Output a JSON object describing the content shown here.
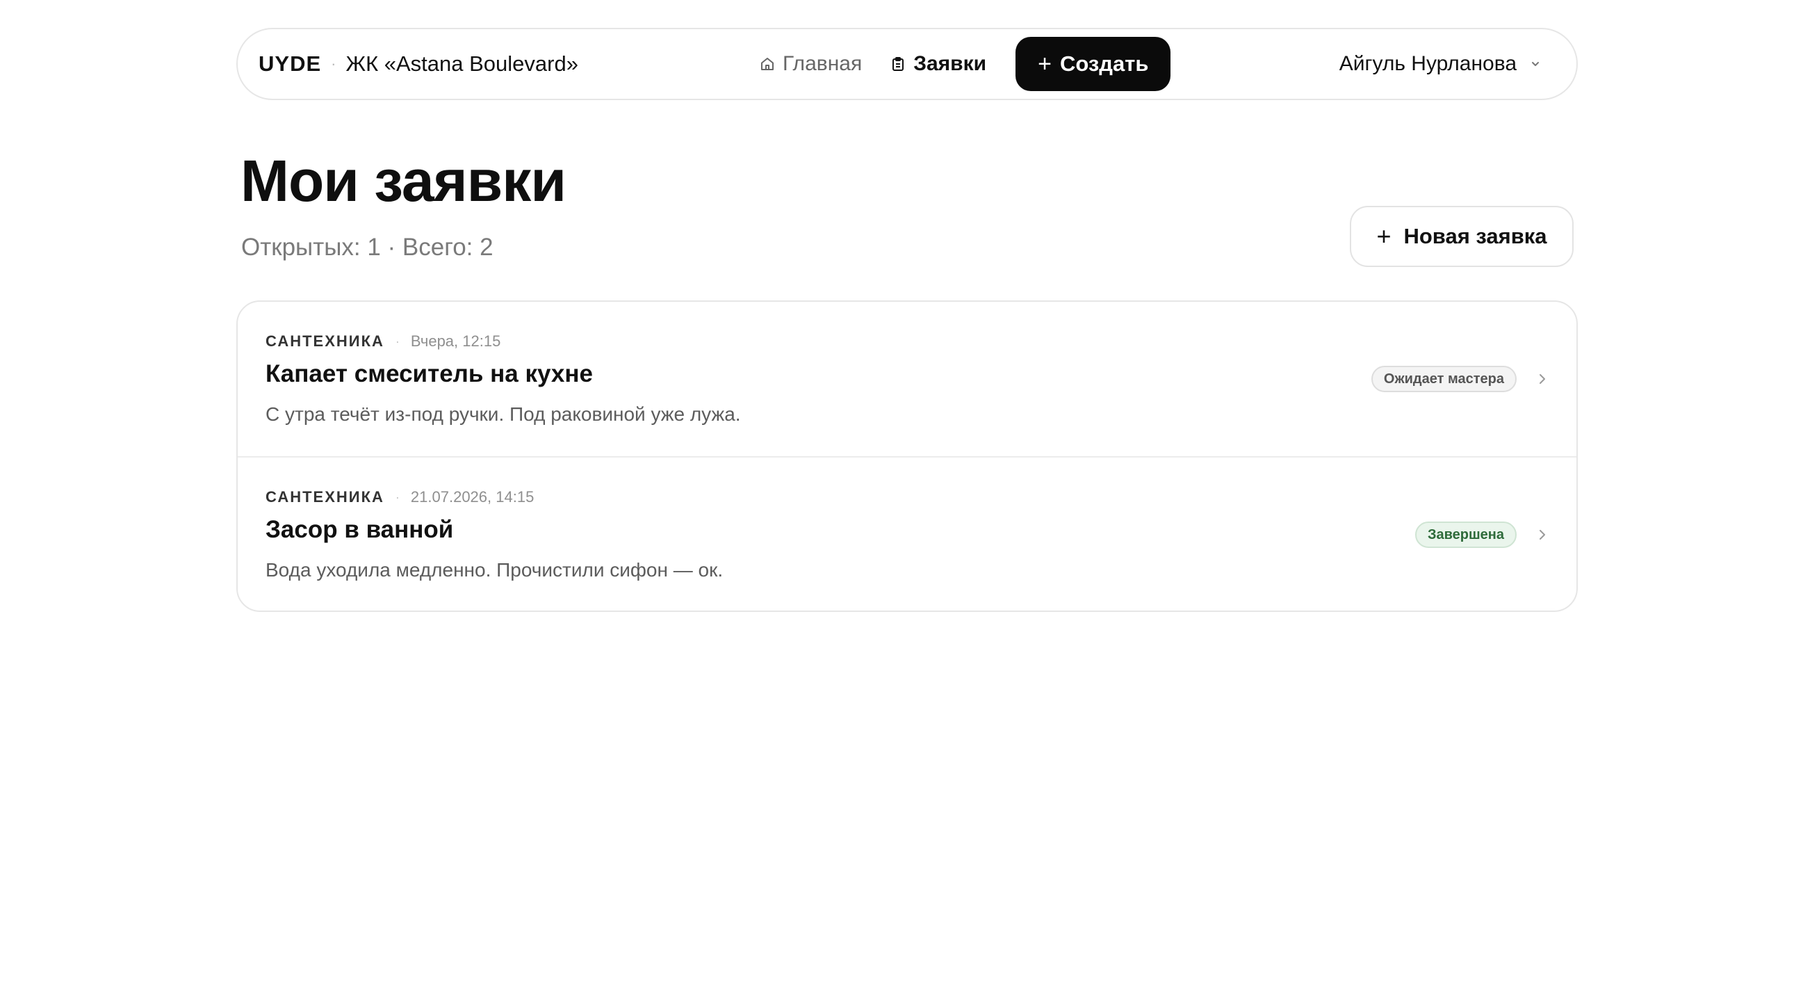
{
  "header": {
    "logo": "UYDE",
    "separator": "·",
    "complex_name": "ЖК «Astana Boulevard»",
    "nav": {
      "home_label": "Главная",
      "requests_label": "Заявки",
      "create_label": "Создать"
    },
    "user_name": "Айгуль Нурланова"
  },
  "main": {
    "title": "Мои заявки",
    "subtitle": "Открытых: 1 · Всего: 2",
    "new_request_label": "Новая заявка",
    "requests": [
      {
        "category": "САНТЕХНИКА",
        "date": "Вчера, 12:15",
        "title": "Капает смеситель на кухне",
        "description": "С утра течёт из-под ручки. Под раковиной уже лужа.",
        "status": "Ожидает мастера"
      },
      {
        "category": "САНТЕХНИКА",
        "date": "21.07.2026, 14:15",
        "title": "Засор в ванной",
        "description": "Вода уходила медленно. Прочистили сифон — ок.",
        "status": "Завершена"
      }
    ]
  },
  "icons": {
    "home": "home-icon",
    "requests": "clipboard-icon",
    "user_menu": "chevron-down-icon",
    "row_open": "chevron-right-icon"
  },
  "colors": {
    "primary_button": "#0b0b0b",
    "status_pending_bg": "#f4f4f4",
    "status_done_bg": "#eaf5ec",
    "status_done_text": "#2e6b3a"
  }
}
